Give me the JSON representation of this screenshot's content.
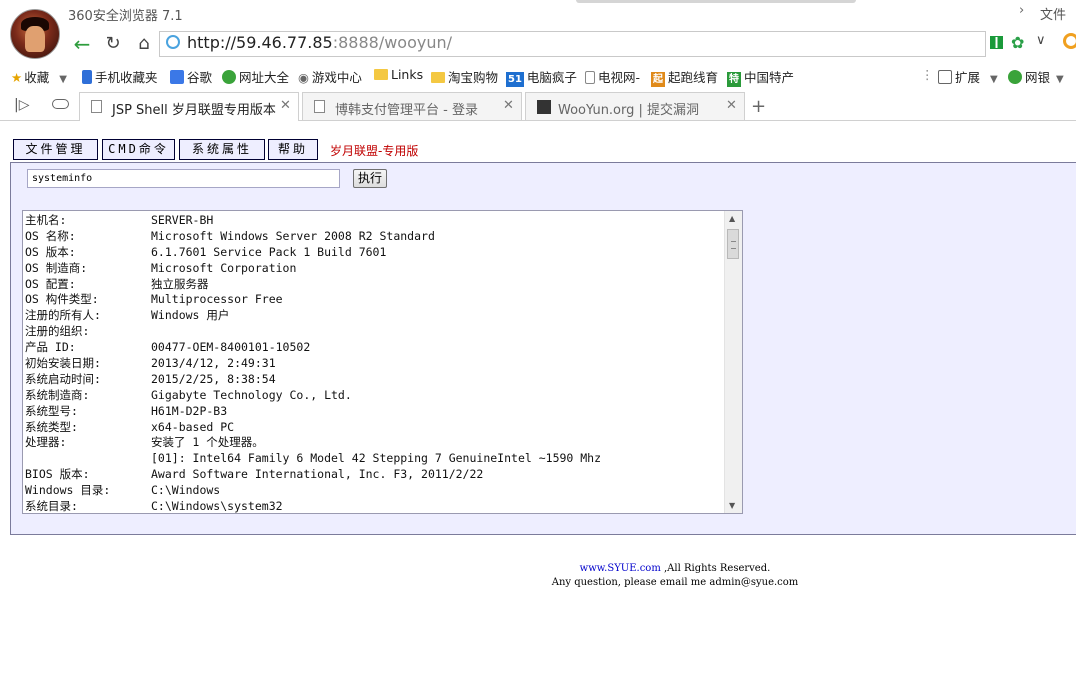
{
  "window": {
    "app_title": "360安全浏览器 7.1",
    "file_menu": "文件"
  },
  "address_bar": {
    "url_host": "http://59.46.77.85",
    "url_rest": ":8888/wooyun/"
  },
  "bookmarks": [
    "收藏",
    "手机收藏夹",
    "谷歌",
    "网址大全",
    "游戏中心",
    "Links",
    "淘宝购物",
    "电脑疯子",
    "电视网-",
    "起跑线育",
    "中国特产",
    "扩展",
    "网银"
  ],
  "bookmark_badges": {
    "pc": "51",
    "qipao": "起",
    "tech": "特"
  },
  "tabs": [
    {
      "label": "JSP Shell 岁月联盟专用版本",
      "active": true
    },
    {
      "label": "博韩支付管理平台 - 登录",
      "active": false
    },
    {
      "label": "WooYun.org | 提交漏洞",
      "active": false
    }
  ],
  "shell_menu": {
    "file_mgmt": "文件管理",
    "cmd": "CMD命令",
    "sys_props": "系统属性",
    "help": "帮助",
    "brand": "岁月联盟-专用版"
  },
  "command": {
    "value": "systeminfo",
    "execute_label": "执行"
  },
  "output": [
    {
      "k": "主机名:",
      "v": "SERVER-BH"
    },
    {
      "k": "OS 名称:",
      "v": "Microsoft Windows Server 2008 R2 Standard"
    },
    {
      "k": "OS 版本:",
      "v": "6.1.7601 Service Pack 1 Build 7601"
    },
    {
      "k": "OS 制造商:",
      "v": "Microsoft Corporation"
    },
    {
      "k": "OS 配置:",
      "v": "独立服务器"
    },
    {
      "k": "OS 构件类型:",
      "v": "Multiprocessor Free"
    },
    {
      "k": "注册的所有人:",
      "v": "Windows 用户"
    },
    {
      "k": "注册的组织:",
      "v": ""
    },
    {
      "k": "产品 ID:",
      "v": "00477-OEM-8400101-10502"
    },
    {
      "k": "初始安装日期:",
      "v": "2013/4/12, 2:49:31"
    },
    {
      "k": "系统启动时间:",
      "v": "2015/2/25, 8:38:54"
    },
    {
      "k": "系统制造商:",
      "v": "Gigabyte Technology Co., Ltd."
    },
    {
      "k": "系统型号:",
      "v": "H61M-D2P-B3"
    },
    {
      "k": "系统类型:",
      "v": "x64-based PC"
    },
    {
      "k": "处理器:",
      "v": "安装了 1 个处理器。"
    },
    {
      "k": "",
      "v": "[01]: Intel64 Family 6 Model 42 Stepping 7 GenuineIntel ~1590 Mhz"
    },
    {
      "k": "BIOS 版本:",
      "v": "Award Software International, Inc. F3, 2011/2/22"
    },
    {
      "k": "Windows 目录:",
      "v": "C:\\Windows"
    },
    {
      "k": "系统目录:",
      "v": "C:\\Windows\\system32"
    }
  ],
  "footer": {
    "link": "www.SYUE.com",
    "rights": ",All Rights Reserved.",
    "contact": "Any question, please email me admin@syue.com"
  }
}
